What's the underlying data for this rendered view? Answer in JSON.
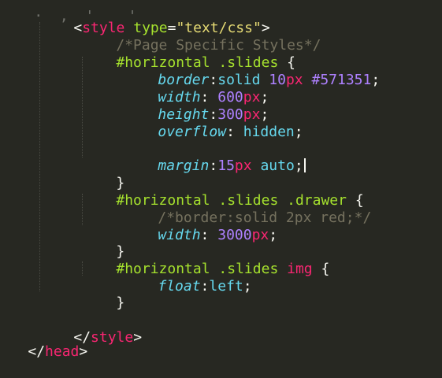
{
  "editor": {
    "line0": {
      "rest": "·  ,  '    '"
    },
    "line1": {
      "open": "<",
      "tag": "style",
      "attr": "type",
      "eq": "=",
      "val": "\"text/css\"",
      "close": ">"
    },
    "line2": {
      "comment": "/*Page Specific Styles*/"
    },
    "line3": {
      "sel_id": "#horizontal",
      "sel_cls": ".slides",
      "brace": "{"
    },
    "line4": {
      "prop": "border",
      "colon": ":",
      "kw": "solid",
      "num": "10",
      "unit": "px",
      "color": "#571351",
      "semi": ";"
    },
    "line5": {
      "prop": "width",
      "colon": ":",
      "num": "600",
      "unit": "px",
      "semi": ";"
    },
    "line6": {
      "prop": "height",
      "colon": ":",
      "num": "300",
      "unit": "px",
      "semi": ";"
    },
    "line7": {
      "prop": "overflow",
      "colon": ":",
      "kw": "hidden",
      "semi": ";"
    },
    "line8": {
      "blank": ""
    },
    "line9": {
      "prop": "margin",
      "colon": ":",
      "num": "15",
      "unit": "px",
      "kw": "auto",
      "semi": ";"
    },
    "line10": {
      "brace": "}"
    },
    "line11": {
      "sel_id": "#horizontal",
      "sel_cls": ".slides",
      "sel_cls2": ".drawer",
      "brace": "{"
    },
    "line12": {
      "comment": "/*border:solid 2px red;*/"
    },
    "line13": {
      "prop": "width",
      "colon": ":",
      "num": "3000",
      "unit": "px",
      "semi": ";"
    },
    "line14": {
      "brace": "}"
    },
    "line15": {
      "sel_id": "#horizontal",
      "sel_cls": ".slides",
      "sel_tag": "img",
      "brace": "{"
    },
    "line16": {
      "prop": "float",
      "colon": ":",
      "kw": "left",
      "semi": ";"
    },
    "line17": {
      "brace": "}"
    },
    "line18": {
      "blank": ""
    },
    "line19": {
      "open": "</",
      "tag": "style",
      "close": ">"
    },
    "line20": {
      "open": "</",
      "tag": "head",
      "close": ">"
    }
  }
}
